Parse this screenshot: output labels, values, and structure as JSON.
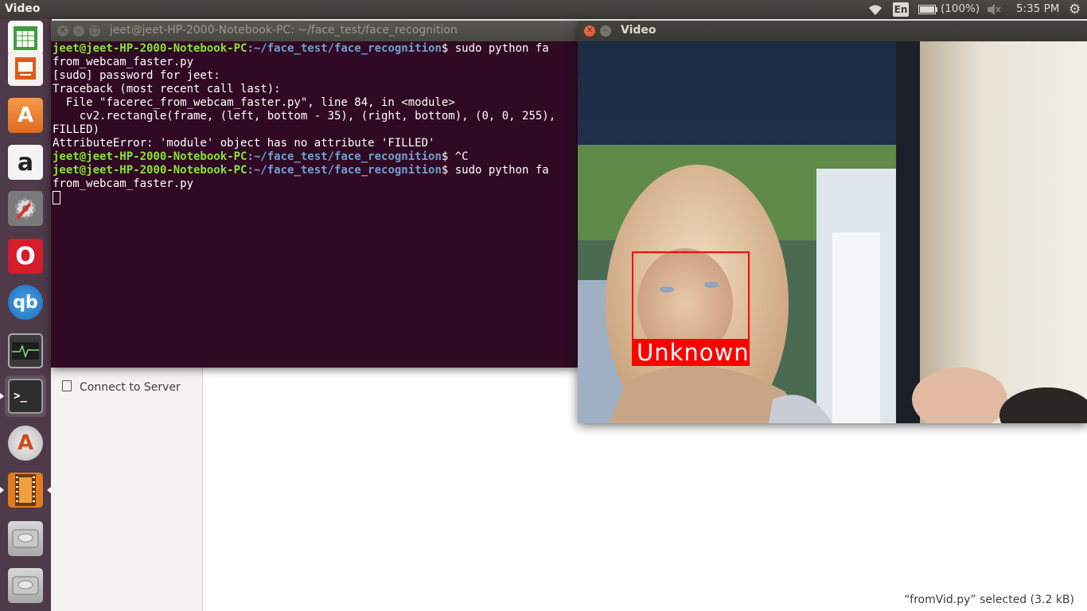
{
  "top_panel": {
    "app_name": "Video",
    "keyboard_layout": "En",
    "battery": "(100%)",
    "clock": "5:35 PM",
    "icons": [
      "wifi-icon",
      "battery-icon",
      "volume-muted-icon",
      "gear-icon"
    ]
  },
  "launcher": {
    "items": [
      {
        "name": "libreoffice-calc",
        "icon": "spreadsheet-icon"
      },
      {
        "name": "libreoffice-impress",
        "icon": "presentation-icon"
      },
      {
        "name": "ubuntu-software",
        "icon": "software-center-icon"
      },
      {
        "name": "amazon",
        "icon": "amazon-icon",
        "glyph": "a"
      },
      {
        "name": "system-settings",
        "icon": "settings-icon"
      },
      {
        "name": "opera",
        "icon": "opera-icon",
        "glyph": "O"
      },
      {
        "name": "qbittorrent",
        "icon": "qbittorrent-icon",
        "glyph": "qb"
      },
      {
        "name": "system-monitor",
        "icon": "system-monitor-icon"
      },
      {
        "name": "terminal",
        "icon": "terminal-icon",
        "glyph": ">_"
      },
      {
        "name": "software-updater",
        "icon": "updater-icon",
        "glyph": "A"
      },
      {
        "name": "videos",
        "icon": "video-player-icon"
      },
      {
        "name": "drive-1",
        "icon": "hard-drive-icon"
      },
      {
        "name": "drive-2",
        "icon": "hard-drive-icon"
      }
    ]
  },
  "terminal": {
    "title": "jeet@jeet-HP-2000-Notebook-PC: ~/face_test/face_recognition",
    "lines": [
      {
        "user": "jeet@jeet-HP-2000-Notebook-PC",
        "path": ":~/face_test/face_recognition",
        "text": "$ sudo python fa"
      },
      {
        "text": "from_webcam_faster.py"
      },
      {
        "text": "[sudo] password for jeet:"
      },
      {
        "text": "Traceback (most recent call last):"
      },
      {
        "text": "  File \"facerec_from_webcam_faster.py\", line 84, in <module>"
      },
      {
        "text": "    cv2.rectangle(frame, (left, bottom - 35), (right, bottom), (0, 0, 255),"
      },
      {
        "text": "FILLED)"
      },
      {
        "text": "AttributeError: 'module' object has no attribute 'FILLED'"
      },
      {
        "user": "jeet@jeet-HP-2000-Notebook-PC",
        "path": ":~/face_test/face_recognition",
        "text": "$ ^C"
      },
      {
        "user": "jeet@jeet-HP-2000-Notebook-PC",
        "path": ":~/face_test/face_recognition",
        "text": "$ sudo python fa"
      },
      {
        "text": "from_webcam_faster.py"
      }
    ]
  },
  "video_window": {
    "title": "Video",
    "face_label": "Unknown"
  },
  "files": {
    "sidebar_item": "Connect to Server",
    "status": "“fromVid.py” selected  (3.2 kB)"
  }
}
